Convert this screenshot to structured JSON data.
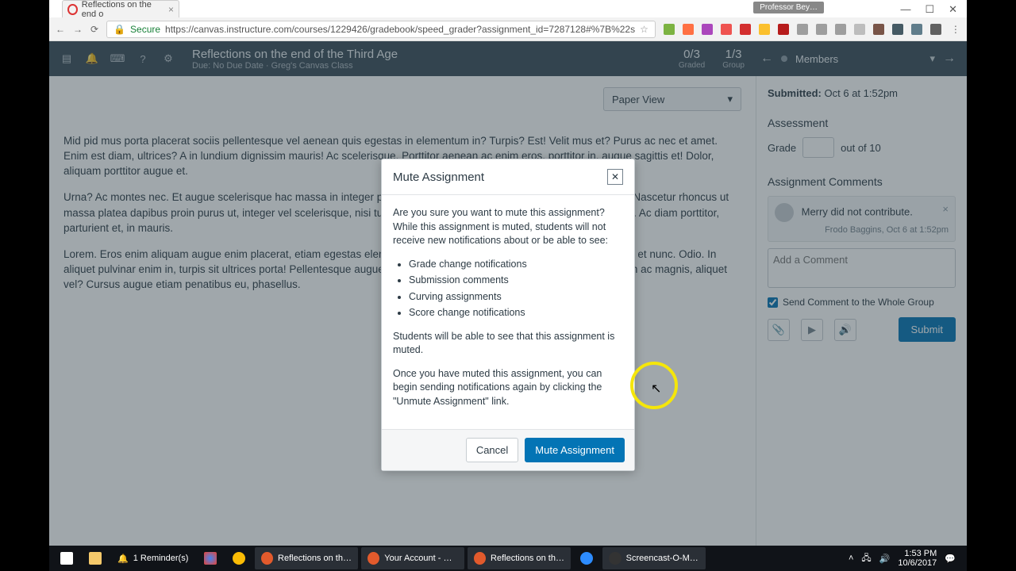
{
  "browser": {
    "tab_title": "Reflections on the end o",
    "user_chip": "Professor Bey…",
    "secure_label": "Secure",
    "url": "https://canvas.instructure.com/courses/1229426/gradebook/speed_grader?assignment_id=7287128#%7B%22s"
  },
  "header": {
    "title": "Reflections on the end of the Third Age",
    "subtitle": "Due: No Due Date · Greg's Canvas Class",
    "graded_num": "0/3",
    "graded_lbl": "Graded",
    "group_num": "1/3",
    "group_lbl": "Group",
    "student": "Members"
  },
  "document": {
    "view_mode": "Paper View",
    "p1": "Mid pid mus porta placerat sociis pellentesque vel aenean quis egestas in elementum in? Turpis? Est! Velit mus et? Purus ac nec et amet. Enim est diam, ultrices? A in lundium dignissim mauris! Ac scelerisque. Porttitor aenean ac enim eros, porttitor in, augue sagittis et! Dolor, aliquam porttitor augue et.",
    "p2": "Urna? Ac montes nec. Et augue scelerisque hac massa in integer porttitor velit nunc sociis nunc mid placerat eu! Enim? Nascetur rhoncus ut massa platea dapibus proin purus ut, integer vel scelerisque, nisi turpis! Turpis, massa amet sit a nunc amet risus augue. Ac diam porttitor, parturient et, in mauris.",
    "p3": "Lorem. Eros enim aliquam augue enim placerat, etiam egestas elementum ac dictumst, vel velit aliquam magnis et, in ac et nunc. Odio. In aliquet pulvinar enim in, turpis sit ultrices porta! Pellentesque augue. Quis. Augue ultricies rhoncus, integer penatibus non ac magnis, aliquet vel? Cursus augue etiam penatibus eu, phasellus."
  },
  "sidebar": {
    "submitted_label": "Submitted:",
    "submitted_value": "Oct 6 at 1:52pm",
    "assessment_heading": "Assessment",
    "grade_label": "Grade",
    "grade_suffix": "out of 10",
    "comments_heading": "Assignment Comments",
    "comment_text": "Merry did not contribute.",
    "comment_author": "Frodo Baggins, Oct 6 at 1:52pm",
    "add_comment_placeholder": "Add a Comment",
    "send_group_label": "Send Comment to the Whole Group",
    "submit_label": "Submit"
  },
  "modal": {
    "title": "Mute Assignment",
    "intro": "Are you sure you want to mute this assignment? While this assignment is muted, students will not receive new notifications about or be able to see:",
    "items": {
      "0": "Grade change notifications",
      "1": "Submission comments",
      "2": "Curving assignments",
      "3": "Score change notifications"
    },
    "note1": "Students will be able to see that this assignment is muted.",
    "note2": "Once you have muted this assignment, you can begin sending notifications again by clicking the \"Unmute Assignment\" link.",
    "cancel": "Cancel",
    "confirm": "Mute Assignment"
  },
  "taskbar": {
    "reminder": "1 Reminder(s)",
    "apps": {
      "0": "Reflections on the …",
      "1": "Your Account - Go…",
      "2": "Reflections on the …",
      "3": "Screencast-O-Matic"
    },
    "time": "1:53 PM",
    "date": "10/6/2017"
  }
}
